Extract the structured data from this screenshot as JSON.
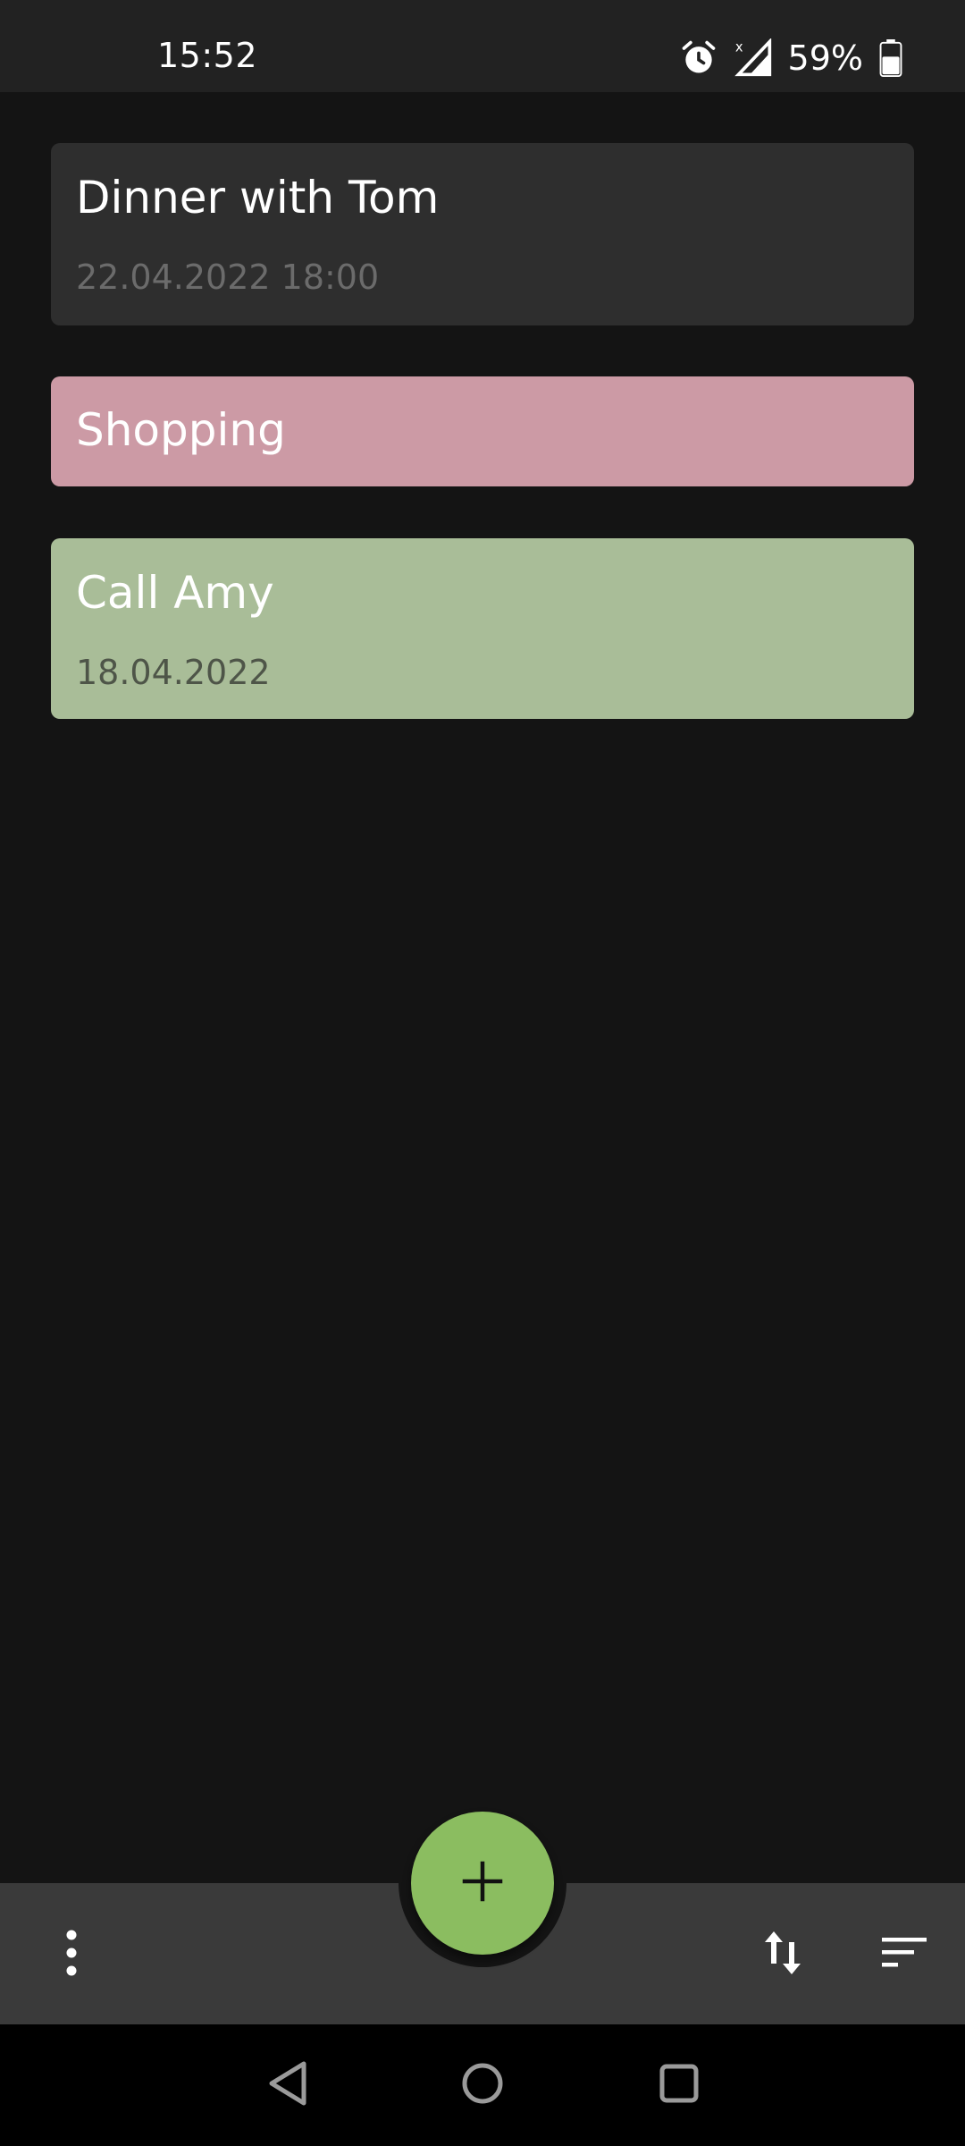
{
  "status_bar": {
    "time": "15:52",
    "battery_percent": "59%",
    "battery_level": 0.59,
    "icons": [
      "alarm-icon",
      "signal-no-data-icon",
      "battery-icon"
    ]
  },
  "notes": [
    {
      "title": "Dinner with Tom",
      "date": "22.04.2022 18:00",
      "color": "#2e2e2e"
    },
    {
      "title": "Shopping",
      "date": "",
      "color": "#cc9aa5"
    },
    {
      "title": "Call Amy",
      "date": "18.04.2022",
      "color": "#a9bd98"
    }
  ],
  "bottom_bar": {
    "left_icon": "more-vertical-icon",
    "fab_icon": "plus-icon",
    "fab_color": "#8bbd60",
    "right_icons": [
      "sort-icon",
      "filter-list-icon"
    ]
  },
  "navigation_bar": {
    "icons": [
      "back-icon",
      "home-icon",
      "recents-icon"
    ]
  }
}
